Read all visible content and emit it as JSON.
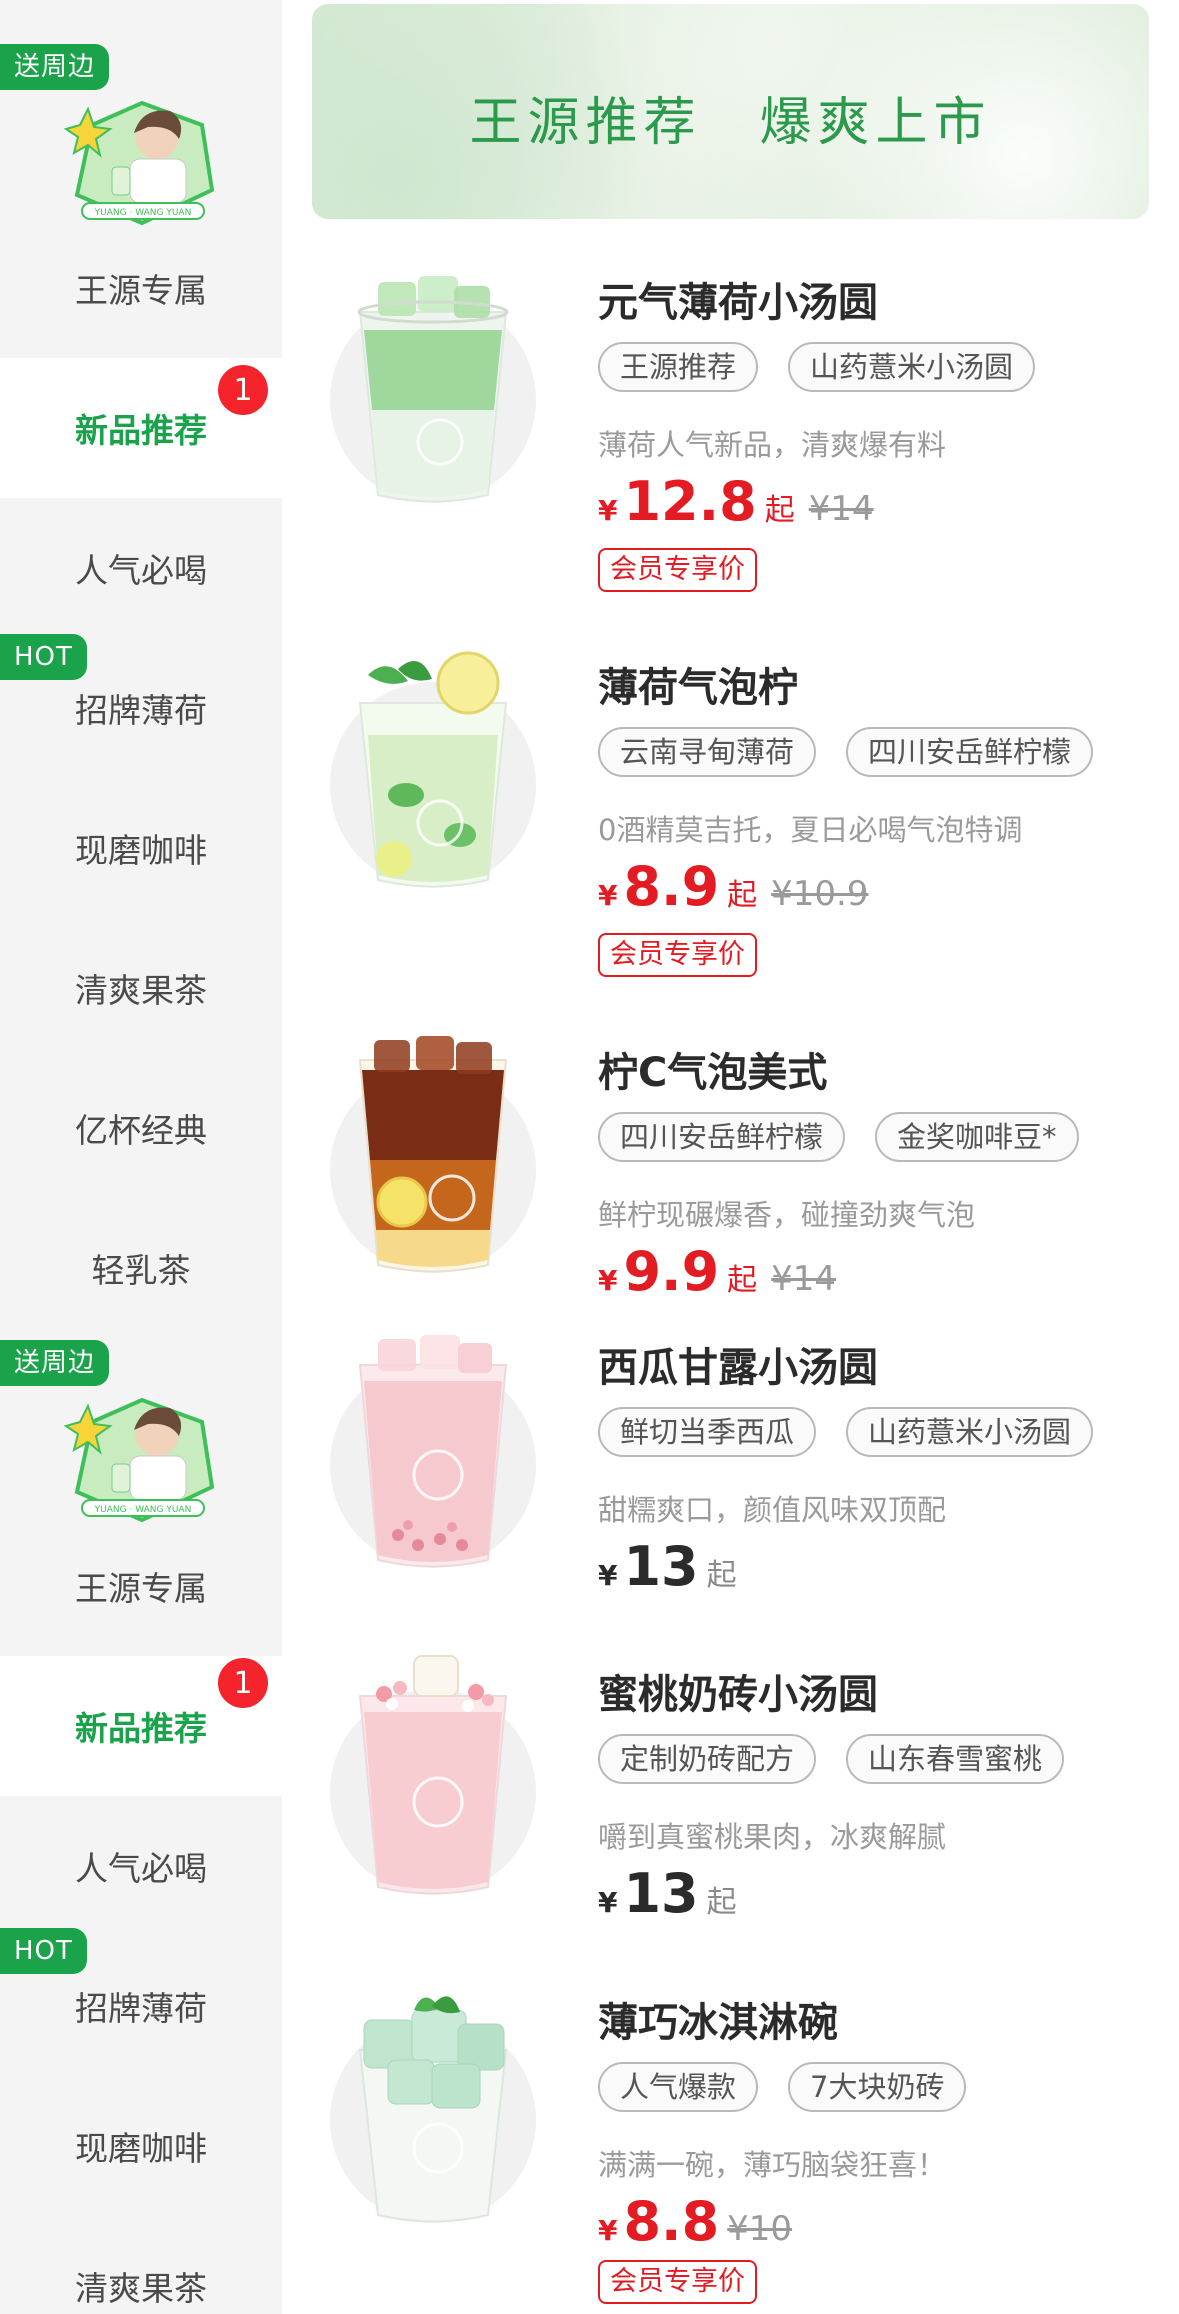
{
  "sidebar": {
    "items": [
      {
        "label": "王源专属",
        "tag": "送周边",
        "badge": null,
        "active": false,
        "type": "promo"
      },
      {
        "label": "新品推荐",
        "tag": null,
        "badge": "1",
        "active": true,
        "type": "normal"
      },
      {
        "label": "人气必喝",
        "tag": null,
        "badge": null,
        "active": false,
        "type": "normal"
      },
      {
        "label": "招牌薄荷",
        "tag": "HOT",
        "badge": null,
        "active": false,
        "type": "normal"
      },
      {
        "label": "现磨咖啡",
        "tag": null,
        "badge": null,
        "active": false,
        "type": "normal"
      },
      {
        "label": "清爽果茶",
        "tag": null,
        "badge": null,
        "active": false,
        "type": "normal"
      },
      {
        "label": "亿杯经典",
        "tag": null,
        "badge": null,
        "active": false,
        "type": "normal"
      },
      {
        "label": "轻乳茶",
        "tag": null,
        "badge": null,
        "active": false,
        "type": "normal"
      },
      {
        "label": "王源专属",
        "tag": "送周边",
        "badge": null,
        "active": false,
        "type": "promo"
      },
      {
        "label": "新品推荐",
        "tag": null,
        "badge": "1",
        "active": true,
        "type": "normal"
      },
      {
        "label": "人气必喝",
        "tag": null,
        "badge": null,
        "active": false,
        "type": "normal"
      },
      {
        "label": "招牌薄荷",
        "tag": "HOT",
        "badge": null,
        "active": false,
        "type": "normal"
      },
      {
        "label": "现磨咖啡",
        "tag": null,
        "badge": null,
        "active": false,
        "type": "normal"
      },
      {
        "label": "清爽果茶",
        "tag": null,
        "badge": null,
        "active": false,
        "type": "normal"
      }
    ],
    "promo_art_text": "YUANG · WANG YUAN"
  },
  "banner": {
    "title": "王源推荐　爆爽上市"
  },
  "currency": "¥",
  "qi_label": "起",
  "products": [
    {
      "name": "元气薄荷小汤圆",
      "tags": [
        "王源推荐",
        "山药薏米小汤圆"
      ],
      "desc": "薄荷人气新品，清爽爆有料",
      "price": "12.8",
      "qi": "起",
      "old_price": "¥14",
      "member": "会员专享价",
      "style": "red",
      "drink": "mint-latte"
    },
    {
      "name": "薄荷气泡柠",
      "tags": [
        "云南寻甸薄荷",
        "四川安岳鲜柠檬"
      ],
      "desc": "0酒精莫吉托，夏日必喝气泡特调",
      "price": "8.9",
      "qi": "起",
      "old_price": "¥10.9",
      "member": "会员专享价",
      "style": "red",
      "drink": "mojito"
    },
    {
      "name": "柠C气泡美式",
      "tags": [
        "四川安岳鲜柠檬",
        "金奖咖啡豆*"
      ],
      "desc": "鲜柠现碾爆香，碰撞劲爽气泡",
      "price": "9.9",
      "qi": "起",
      "old_price": "¥14",
      "member": null,
      "style": "red",
      "drink": "lemon-americano"
    },
    {
      "name": "西瓜甘露小汤圆",
      "tags": [
        "鲜切当季西瓜",
        "山药薏米小汤圆"
      ],
      "desc": "甜糯爽口，颜值风味双顶配",
      "price": "13",
      "qi": "起",
      "old_price": null,
      "member": null,
      "style": "dark",
      "drink": "watermelon"
    },
    {
      "name": "蜜桃奶砖小汤圆",
      "tags": [
        "定制奶砖配方",
        "山东春雪蜜桃"
      ],
      "desc": "嚼到真蜜桃果肉，冰爽解腻",
      "price": "13",
      "qi": "起",
      "old_price": null,
      "member": null,
      "style": "dark",
      "drink": "peach"
    },
    {
      "name": "薄巧冰淇淋碗",
      "tags": [
        "人气爆款",
        "7大块奶砖"
      ],
      "desc": "满满一碗，薄巧脑袋狂喜！",
      "price": "8.8",
      "qi": "",
      "old_price": "¥10",
      "member": "会员专享价",
      "style": "red",
      "drink": "mint-bowl"
    }
  ],
  "icons": {
    "drink_logo": "panda-cup-logo-icon",
    "promo_character": "star-character-icon"
  },
  "colors": {
    "brand_green": "#1aa34a",
    "price_red": "#e31b23",
    "badge_red": "#f4232c"
  }
}
